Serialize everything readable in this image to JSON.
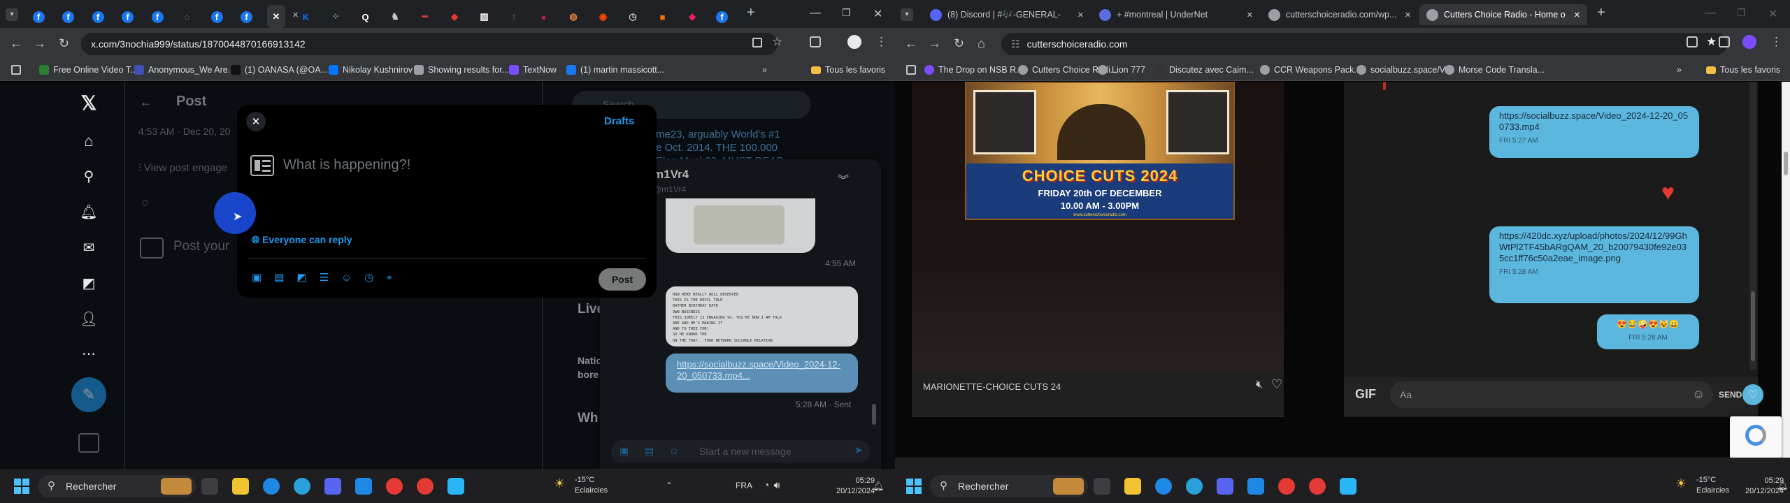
{
  "left": {
    "url": "x.com/3nochia999/status/1870044870166913142",
    "tabs": [
      {
        "icon": "facebook-icon",
        "color": "#1877f2"
      },
      {
        "icon": "facebook-icon",
        "color": "#1877f2"
      },
      {
        "icon": "facebook-icon",
        "color": "#1877f2"
      },
      {
        "icon": "facebook-icon",
        "color": "#1877f2"
      },
      {
        "icon": "facebook-icon",
        "color": "#1877f2"
      },
      {
        "icon": "loader-icon",
        "color": "#9aa0a6"
      },
      {
        "icon": "facebook-icon",
        "color": "#1877f2"
      },
      {
        "icon": "facebook-icon",
        "color": "#1877f2"
      },
      {
        "icon": "x-icon",
        "color": "#ffffff"
      },
      {
        "icon": "vk-icon",
        "color": "#0077ff"
      },
      {
        "icon": "grid-icon",
        "color": "#9aa0a6"
      },
      {
        "icon": "q-icon",
        "color": "#ffffff"
      },
      {
        "icon": "creature-icon",
        "color": "#c4c7c5"
      },
      {
        "icon": "red-dash-icon",
        "color": "#e53935"
      },
      {
        "icon": "shield-icon",
        "color": "#e53935"
      },
      {
        "icon": "image-icon",
        "color": "#ffffff"
      },
      {
        "icon": "tumblr-icon",
        "color": "#36465d"
      },
      {
        "icon": "chat-icon",
        "color": "#c2185b"
      },
      {
        "icon": "spiral-icon",
        "color": "#e07b39"
      },
      {
        "icon": "reddit-icon",
        "color": "#ff4500"
      },
      {
        "icon": "history-icon",
        "color": "#c4c7c5"
      },
      {
        "icon": "orange-square-icon",
        "color": "#ff6d00"
      },
      {
        "icon": "pink-shield-icon",
        "color": "#e91e63"
      },
      {
        "icon": "facebook-icon",
        "color": "#1877f2"
      }
    ],
    "bookmarks": [
      "Free Online Video T...",
      "Anonymous_We Are...",
      "(1) OANASA (@OA...",
      "Nikolay Kushnirov",
      "Showing results for...",
      "TextNow",
      "(1) martin massicott..."
    ],
    "bookmarks_all": "Tous les favoris",
    "x": {
      "back_title": "Post",
      "post_meta": "4:53 AM · Dec 20, 20",
      "view_engagements": "View post engage",
      "reply_placeholder": "Post your",
      "right_text_1": "me23, arguably World's #1",
      "right_text_2": "e Oct. 2014. THE 100.000",
      "right_text_3": "Elon Musk23, MUST READ",
      "search_placeholder": "Search",
      "trending_title": "Live",
      "trending_2": "Natio",
      "trending_3": "bore",
      "who_title": "Wh"
    },
    "compose": {
      "drafts": "Drafts",
      "placeholder": "What is happening?!",
      "reply_setting": "Everyone can reply",
      "post_button": "Post"
    },
    "dm": {
      "name": "m1Vr4",
      "handle": "@m1Vr4",
      "time1": "4:55 AM",
      "note_lines": [
        "HOW HERE REALLY WELL OBSERVED",
        "THIS IS THE DEVIL TOLD",
        "RATHER BIRTHDAY DATE",
        "OWN BUSINESS",
        "THIS SURELY IS ENGAGING SO, YOU'RE NOW I AM TOLD",
        "ONE AND HE'S MAKING IT",
        "AND TO THEE FOR!",
        "SO HE KNOWS THE",
        "ON THE THAT...FOUR NETWORK SOCIABLE RELATION"
      ],
      "link": "https://socialbuzz.space/Video_2024-12-20_050733.mp4...",
      "time2": "5:28 AM · Sent",
      "input_placeholder": "Start a new message"
    }
  },
  "right": {
    "url": "cutterschoiceradio.com",
    "tabs": [
      {
        "label": "(8) Discord | #🎶-GENERAL-",
        "icon": "discord-icon",
        "color": "#5865f2"
      },
      {
        "label": "+ #montreal | UnderNet",
        "icon": "irc-icon",
        "color": "#5b6ee1"
      },
      {
        "label": "cutterschoiceradio.com/wp...",
        "icon": "globe-icon",
        "color": "#9aa0a6"
      },
      {
        "label": "Cutters Choice Radio - Home o",
        "icon": "globe-icon",
        "color": "#9aa0a6"
      }
    ],
    "bookmarks": [
      "The Drop on NSB R...",
      "Cutters Choice Radi...",
      "Lion 777",
      "Discutez avec Caim...",
      "CCR Weapons Pack...",
      "socialbuzz.space/Vi...",
      "Morse Code Transla..."
    ],
    "bookmarks_all": "Tous les favoris",
    "poster": {
      "title": "CHOICE CUTS 2024",
      "subtitle": "FRIDAY 20th OF DECEMBER",
      "hours": "10.00 AM - 3.00PM",
      "footer": "www.cutterschoiceradio.com"
    },
    "now_playing": "MARIONETTE-CHOICE CUTS 24",
    "chat": {
      "messages": [
        {
          "text": "https://socialbuzz.space/Video_2024-12-20_050733.mp4",
          "time": "FRI 5:27 AM"
        },
        {
          "text": "https://420dc.xyz/upload/photos/2024/12/99GhWtPl2TF45bARgQAM_20_b20079430fe92e035cc1ff76c50a2eae_image.png",
          "time": "FRI 5:28 AM"
        },
        {
          "text": "😍😂🤪😍😺😀",
          "time": "FRI 5:28 AM"
        }
      ],
      "gif": "GIF",
      "input_placeholder": "Aa",
      "send": "SEND"
    }
  },
  "taskbar": {
    "search": "Rechercher",
    "weather_temp": "-15°C",
    "weather_desc": "Eclaircies",
    "lang": "FRA",
    "time": "05:29",
    "date": "20/12/2024"
  }
}
